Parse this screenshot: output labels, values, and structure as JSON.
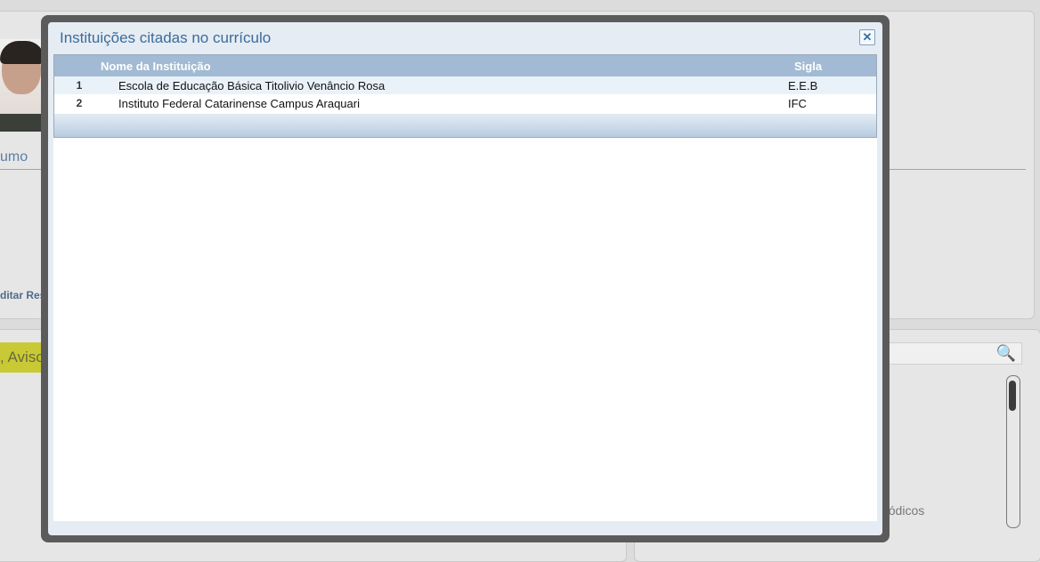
{
  "background": {
    "section_heading": "umo",
    "edit_link": "ditar Res",
    "notice_tab": ", Aviso",
    "periodicos_text": "riódicos"
  },
  "modal": {
    "title": "Instituições citadas no currículo",
    "close_icon": "close-icon",
    "columns": {
      "name": "Nome da Instituição",
      "sigla": "Sigla"
    },
    "rows": [
      {
        "num": "1",
        "name": "Escola de Educação Básica Titolivio Venâncio Rosa",
        "sigla": "E.E.B"
      },
      {
        "num": "2",
        "name": "Instituto Federal Catarinense Campus Araquari",
        "sigla": "IFC"
      }
    ]
  },
  "colors": {
    "title": "#3b6c9a",
    "header_bg": "#a2bad3",
    "row_alt": "#eaf2f9"
  }
}
